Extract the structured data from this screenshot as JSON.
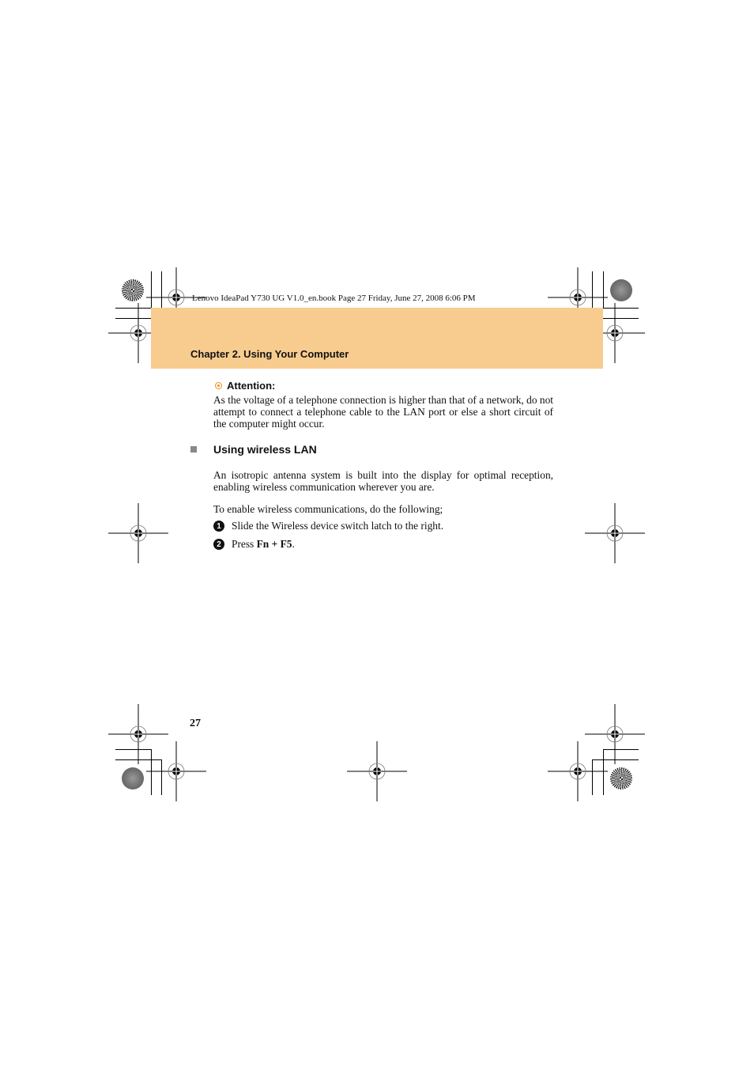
{
  "book_meta": "Lenovo IdeaPad Y730 UG V1.0_en.book  Page 27  Friday, June 27, 2008  6:06 PM",
  "header": {
    "chapter_title": "Chapter 2. Using Your Computer",
    "band_color": "#f8cc8f"
  },
  "attention": {
    "icon": "attention-bullseye-icon",
    "label": "Attention:",
    "icon_color": "#f08c1e",
    "text": "As the voltage of a telephone connection is higher than that of a network, do not attempt to connect a telephone cable to the LAN port or else a short circuit of the computer might occur."
  },
  "section": {
    "bullet_icon": "square-bullet-icon",
    "title": "Using wireless LAN",
    "intro": "An isotropic antenna system is built into the display for optimal reception, enabling wireless communication wherever you are.",
    "lead": "To enable wireless communications, do the following;",
    "steps": [
      {
        "number": "1",
        "text": "Slide the Wireless device switch latch to the right."
      },
      {
        "number": "2",
        "text_prefix": "Press ",
        "keys": "Fn + F5",
        "text_suffix": "."
      }
    ]
  },
  "footer": {
    "page_number": "27"
  }
}
